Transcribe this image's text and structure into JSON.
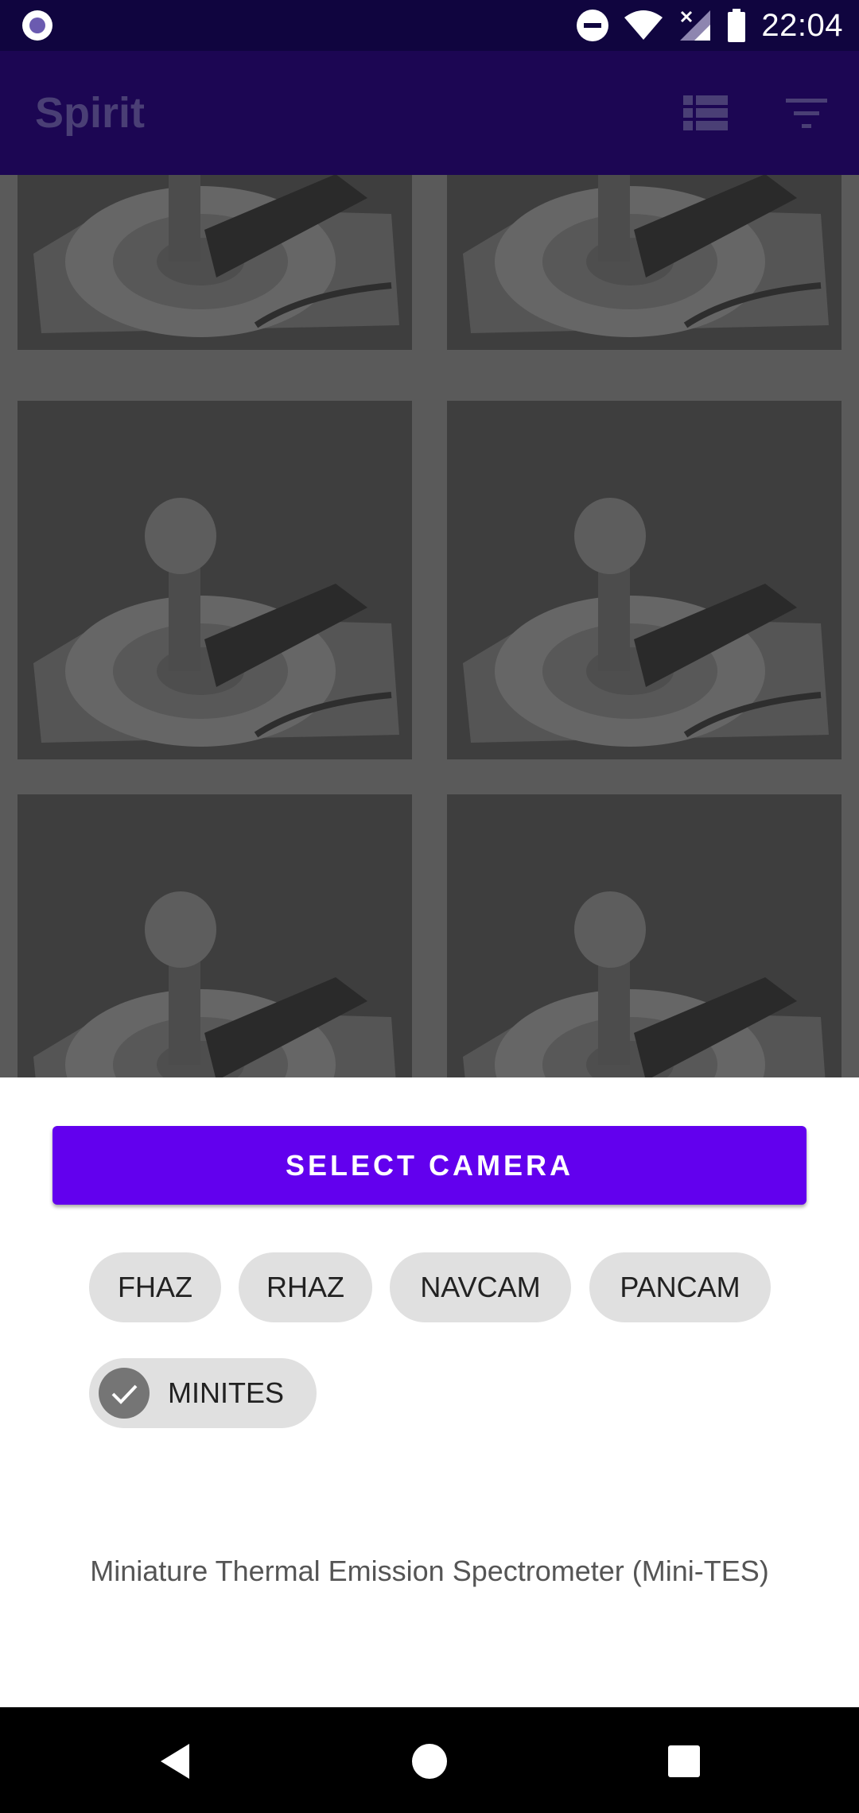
{
  "status_bar": {
    "time": "22:04",
    "icons": [
      "notification-dot-icon",
      "do-not-disturb-icon",
      "wifi-icon",
      "cell-signal-off-icon",
      "battery-icon"
    ]
  },
  "app_bar": {
    "title": "Spirit",
    "actions": [
      "list-view-icon",
      "filter-icon"
    ]
  },
  "gallery": {
    "tile_count": 6,
    "image_description": "calibration target photo"
  },
  "sheet": {
    "button_label": "SELECT CAMERA",
    "chips": [
      {
        "label": "FHAZ",
        "selected": false
      },
      {
        "label": "RHAZ",
        "selected": false
      },
      {
        "label": "NAVCAM",
        "selected": false
      },
      {
        "label": "PANCAM",
        "selected": false
      },
      {
        "label": "MINITES",
        "selected": true
      }
    ],
    "description": "Miniature Thermal Emission Spectrometer (Mini-TES)"
  },
  "nav_bar": {
    "icons": [
      "back-icon",
      "home-icon",
      "recents-icon"
    ]
  },
  "colors": {
    "status_bar": "#10053f",
    "app_bar": "#1c0653",
    "accent": "#6200ee",
    "chip": "#e0e0e0",
    "scrim_grid": "#5a5a5a"
  }
}
